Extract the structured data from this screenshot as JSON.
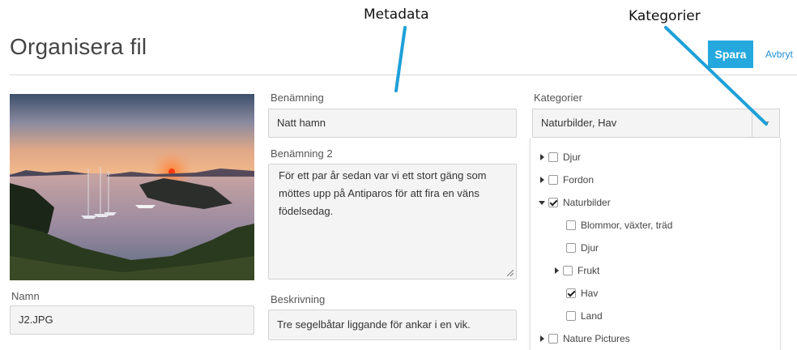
{
  "annotations": {
    "metadata": "Metadata",
    "categories": "Kategorier"
  },
  "header": {
    "title": "Organisera fil",
    "save_label": "Spara",
    "cancel_label": "Avbryt"
  },
  "colors": {
    "accent": "#25a8de",
    "link": "#1f8fd6",
    "annotation_line": "#1ea0d8"
  },
  "file": {
    "name_label": "Namn",
    "name_value": "J2.JPG"
  },
  "metadata_fields": {
    "title_label": "Benämning",
    "title_value": "Natt hamn",
    "title2_label": "Benämning 2",
    "title2_value": "För ett par år sedan var vi ett stort gäng som möttes upp på Antiparos för att fira en väns födelsedag.",
    "description_label": "Beskrivning",
    "description_value": "Tre segelbåtar liggande för ankar i en vik."
  },
  "categories": {
    "label": "Kategorier",
    "selected": "Naturbilder, Hav",
    "tree": [
      {
        "label": "Djur",
        "checked": false,
        "caret": "right"
      },
      {
        "label": "Fordon",
        "checked": false,
        "caret": "right"
      },
      {
        "label": "Naturbilder",
        "checked": true,
        "caret": "down"
      },
      {
        "label": "Blommor, växter, träd",
        "checked": false,
        "caret": "none"
      },
      {
        "label": "Djur",
        "checked": false,
        "caret": "none"
      },
      {
        "label": "Frukt",
        "checked": false,
        "caret": "right"
      },
      {
        "label": "Hav",
        "checked": true,
        "caret": "none"
      },
      {
        "label": "Land",
        "checked": false,
        "caret": "none"
      },
      {
        "label": "Nature Pictures",
        "checked": false,
        "caret": "right"
      }
    ]
  }
}
